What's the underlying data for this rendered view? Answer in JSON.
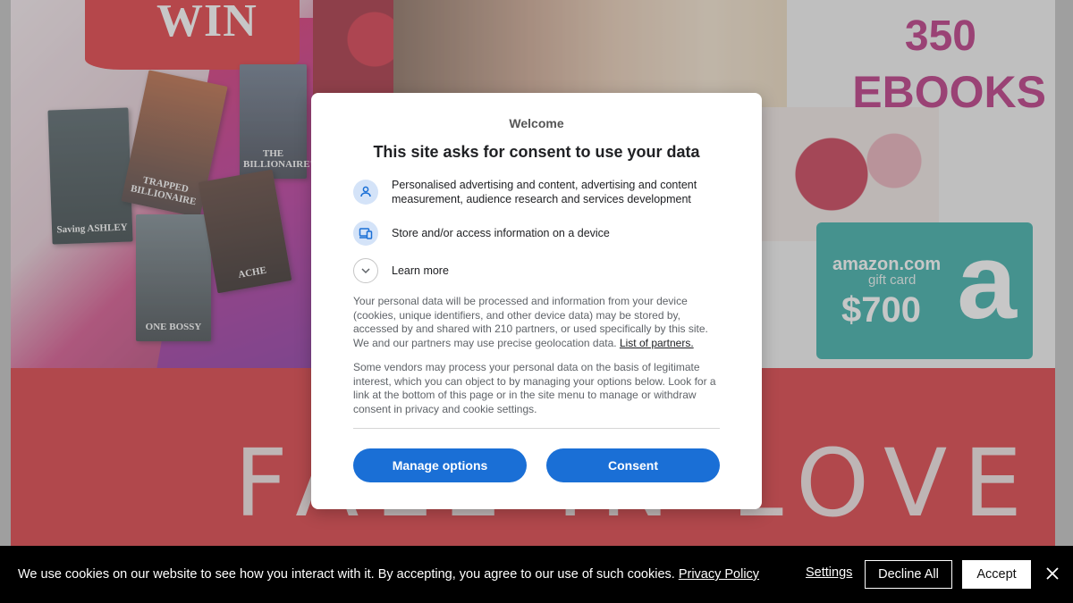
{
  "background": {
    "win_text": "WIN",
    "ebooks_count": "350",
    "ebooks_word": "EBOOKS",
    "giftcard": {
      "brand": "amazon.com",
      "sub": "gift card",
      "amount": "$700",
      "logo": "a"
    },
    "books": [
      "Saving ASHLEY",
      "TRAPPED BILLIONAIRE",
      "THE BILLIONAIRE'S",
      "ONE BOSSY",
      "ACHE"
    ],
    "banner_text": "FALL IN LOVE"
  },
  "consent": {
    "kicker": "Welcome",
    "title": "This site asks for consent to use your data",
    "purposes": [
      {
        "icon": "person-icon",
        "text": "Personalised advertising and content, advertising and content measurement, audience research and services development"
      },
      {
        "icon": "devices-icon",
        "text": "Store and/or access information on a device"
      }
    ],
    "learn_more": "Learn more",
    "paragraph1": "Your personal data will be processed and information from your device (cookies, unique identifiers, and other device data) may be stored by, accessed by and shared with 210 partners, or used specifically by this site. We and our partners may use precise geolocation data.",
    "partners_link": "List of partners.",
    "paragraph2": "Some vendors may process your personal data on the basis of legitimate interest, which you can object to by managing your options below. Look for a link at the bottom of this page or in the site menu to manage or withdraw consent in privacy and cookie settings.",
    "manage_label": "Manage options",
    "consent_label": "Consent",
    "accent": "#1a6fd6"
  },
  "cookie_bar": {
    "text": "We use cookies on our website to see how you interact with it. By accepting, you agree to our use of such cookies.",
    "privacy_link": "Privacy Policy",
    "settings_label": "Settings",
    "decline_label": "Decline All",
    "accept_label": "Accept"
  }
}
